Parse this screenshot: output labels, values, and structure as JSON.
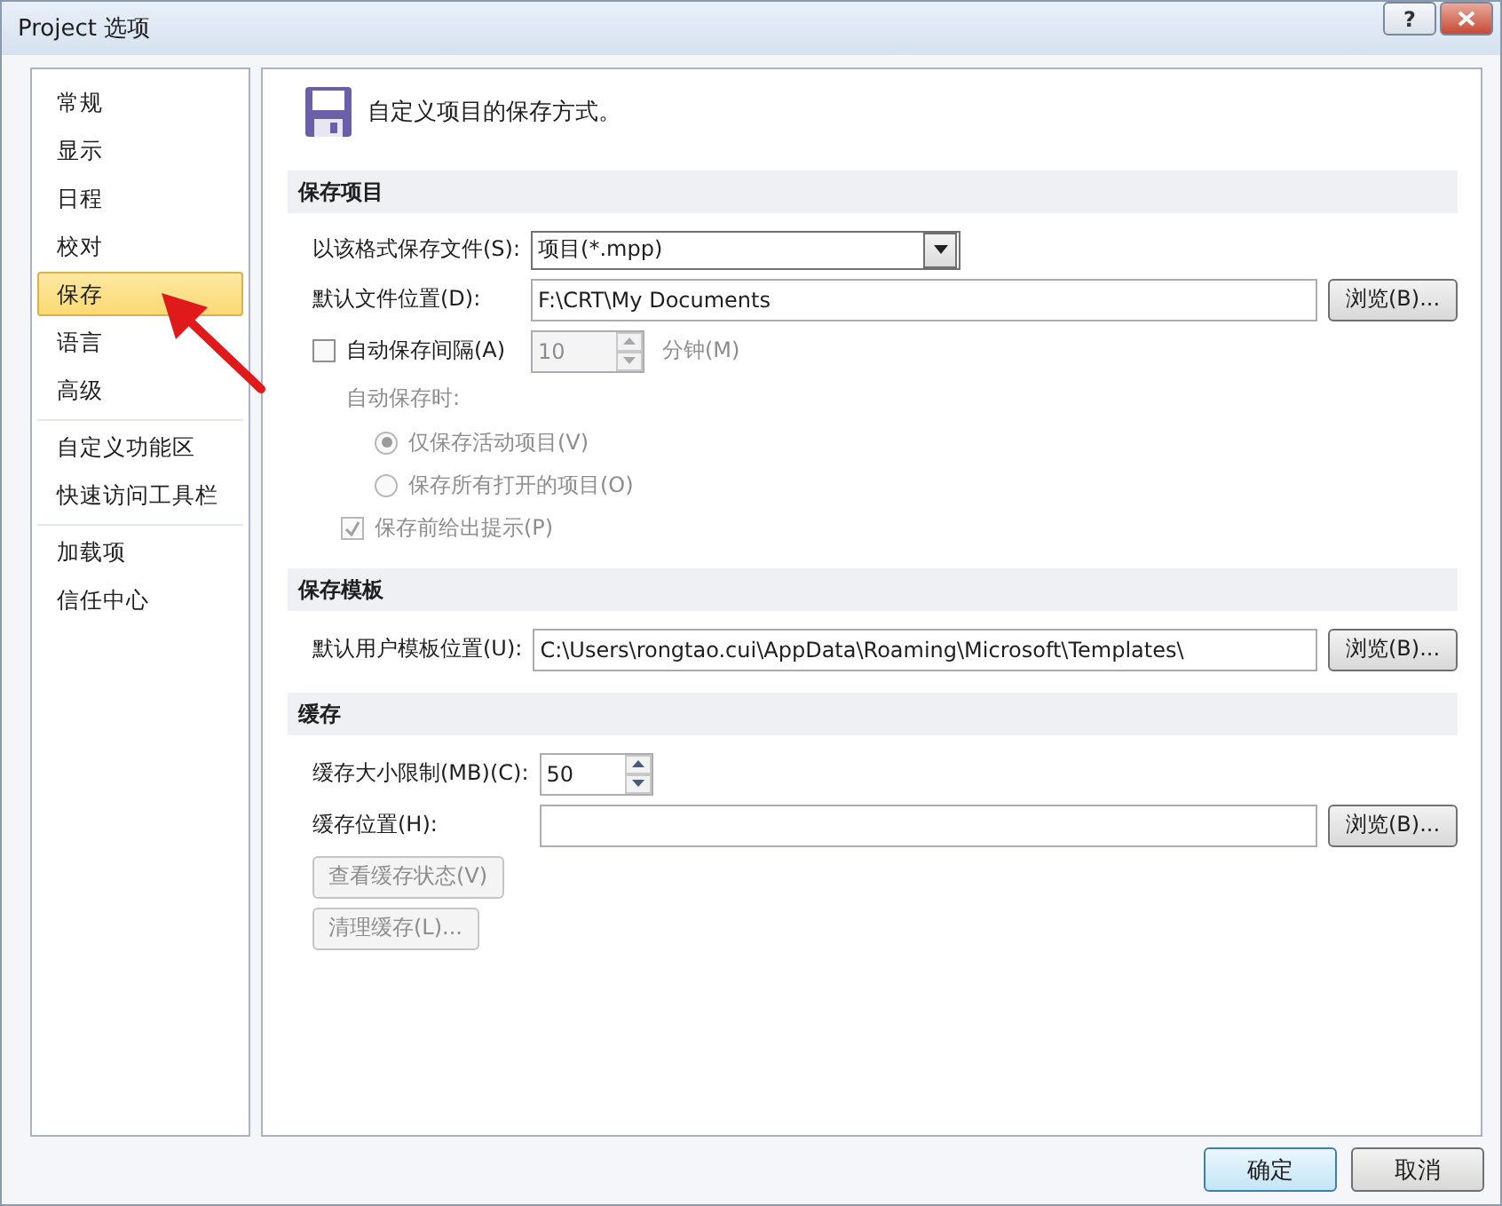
{
  "window": {
    "title": "Project 选项",
    "help": "?"
  },
  "sidebar": {
    "groups": [
      {
        "items": [
          {
            "label": "常规",
            "selected": false
          },
          {
            "label": "显示",
            "selected": false
          },
          {
            "label": "日程",
            "selected": false
          },
          {
            "label": "校对",
            "selected": false
          },
          {
            "label": "保存",
            "selected": true
          },
          {
            "label": "语言",
            "selected": false
          },
          {
            "label": "高级",
            "selected": false
          }
        ]
      },
      {
        "items": [
          {
            "label": "自定义功能区",
            "selected": false
          },
          {
            "label": "快速访问工具栏",
            "selected": false
          }
        ]
      },
      {
        "items": [
          {
            "label": "加载项",
            "selected": false
          },
          {
            "label": "信任中心",
            "selected": false
          }
        ]
      }
    ]
  },
  "intro": "自定义项目的保存方式。",
  "sections": [
    {
      "title": "保存项目",
      "rows": [
        {
          "kind": "select",
          "label": "以该格式保存文件(S):",
          "value": "项目(*.mpp)"
        },
        {
          "kind": "path",
          "label": "默认文件位置(D):",
          "value": "F:\\CRT\\My Documents",
          "button": "浏览(B)..."
        },
        {
          "kind": "checkspin",
          "label": "自动保存间隔(A)",
          "checked": false,
          "value": "10",
          "unit": "分钟(M)",
          "disabled": true
        },
        {
          "kind": "caption",
          "label": "自动保存时:",
          "disabled": true
        },
        {
          "kind": "radio",
          "label": "仅保存活动项目(V)",
          "selected": true,
          "disabled": true
        },
        {
          "kind": "radio",
          "label": "保存所有打开的项目(O)",
          "selected": false,
          "disabled": true
        },
        {
          "kind": "check",
          "label": "保存前给出提示(P)",
          "checked": true,
          "disabled": true
        }
      ]
    },
    {
      "title": "保存模板",
      "rows": [
        {
          "kind": "path",
          "label": "默认用户模板位置(U):",
          "value": "C:\\Users\\rongtao.cui\\AppData\\Roaming\\Microsoft\\Templates\\",
          "button": "浏览(B)..."
        }
      ]
    },
    {
      "title": "缓存",
      "rows": [
        {
          "kind": "spin",
          "label": "缓存大小限制(MB)(C):",
          "value": "50"
        },
        {
          "kind": "path",
          "label": "缓存位置(H):",
          "button": "浏览(B)..."
        },
        {
          "kind": "button",
          "label": "查看缓存状态(V)",
          "disabled": true
        },
        {
          "kind": "button",
          "label": "清理缓存(L)...",
          "disabled": true
        }
      ]
    }
  ],
  "footer": [
    {
      "label": "确定",
      "default": true
    },
    {
      "label": "取消",
      "default": false
    }
  ]
}
